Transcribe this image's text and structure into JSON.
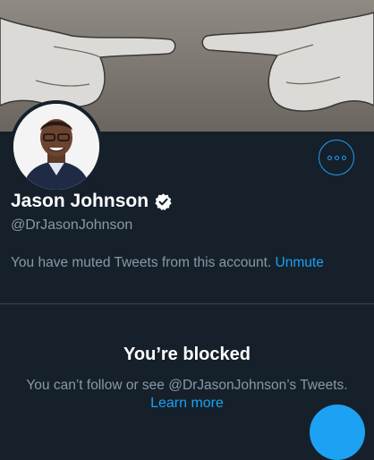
{
  "profile": {
    "display_name": "Jason Johnson",
    "verified_icon": "verified-badge-icon",
    "handle": "@DrJasonJohnson"
  },
  "banner": {
    "description_icon": "pointing-hands-image"
  },
  "actions": {
    "more_icon": "more-options-icon"
  },
  "muted_notice": {
    "text": "You have muted Tweets from this account.",
    "unmute_label": "Unmute"
  },
  "blocked": {
    "title": "You’re blocked",
    "description": "You can’t follow or see @DrJasonJohnson’s Tweets.",
    "learn_more": "Learn more"
  },
  "colors": {
    "background": "#15202b",
    "accent": "#1da1f2",
    "secondary_text": "#8899a6",
    "divider": "#38444d"
  }
}
